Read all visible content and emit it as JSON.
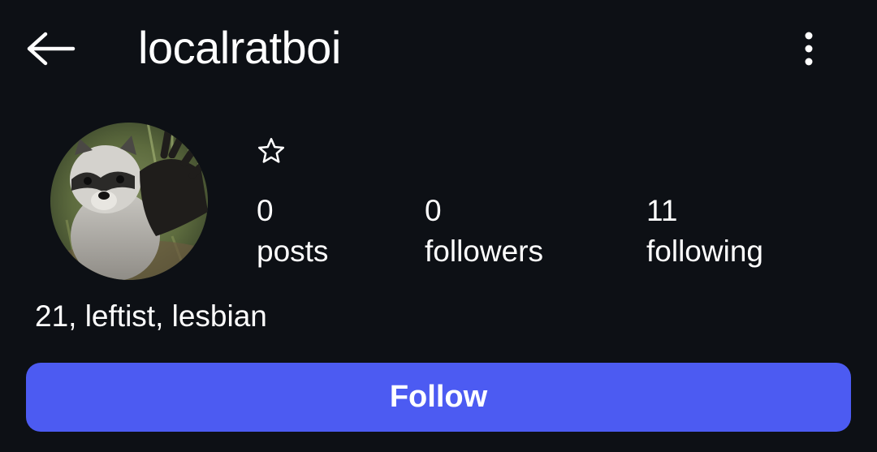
{
  "header": {
    "username": "localratboi",
    "back_icon": "arrow-left-icon",
    "menu_icon": "more-vertical-icon"
  },
  "profile": {
    "avatar_description_icon": "avatar",
    "favorite_icon": "star-outline-icon",
    "stats": [
      {
        "count": "0",
        "label": "posts"
      },
      {
        "count": "0",
        "label": "followers"
      },
      {
        "count": "11",
        "label": "following"
      }
    ],
    "bio": "21, leftist, lesbian"
  },
  "actions": {
    "follow_label": "Follow"
  },
  "colors": {
    "background": "#0d1015",
    "accent": "#4c5bf2",
    "text": "#ffffff"
  }
}
